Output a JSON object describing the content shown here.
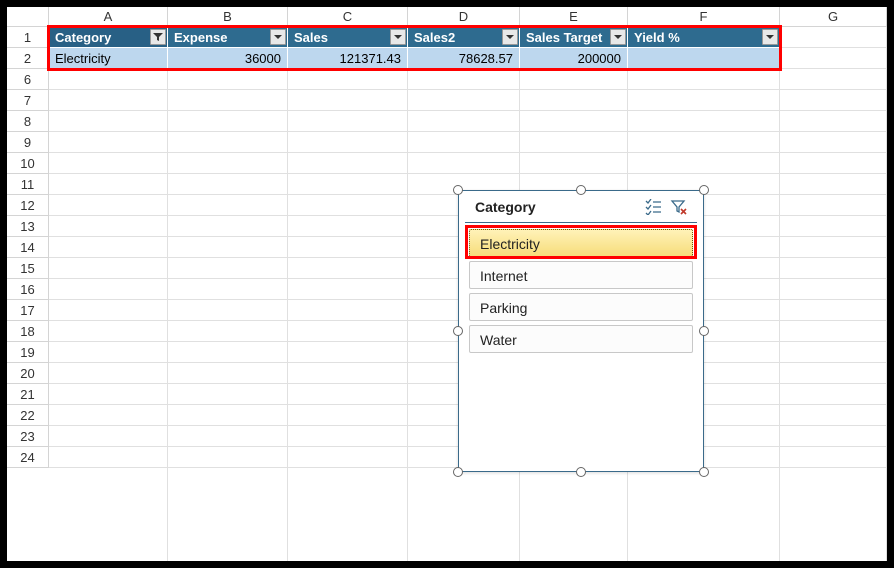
{
  "columns": [
    "A",
    "B",
    "C",
    "D",
    "E",
    "F",
    "G"
  ],
  "rows": [
    "1",
    "2",
    "6",
    "7",
    "8",
    "9",
    "10",
    "11",
    "12",
    "13",
    "14",
    "15",
    "16",
    "17",
    "18",
    "19",
    "20",
    "21",
    "22",
    "23",
    "24"
  ],
  "table": {
    "headers": [
      "Category",
      "Expense",
      "Sales",
      "Sales2",
      "Sales Target",
      "Yield %"
    ],
    "data_row": {
      "category": "Electricity",
      "expense": "36000",
      "sales": "121371.43",
      "sales2": "78628.57",
      "sales_target": "200000",
      "yield": ""
    }
  },
  "slicer": {
    "title": "Category",
    "items": [
      {
        "label": "Electricity",
        "selected": true
      },
      {
        "label": "Internet",
        "selected": false
      },
      {
        "label": "Parking",
        "selected": false
      },
      {
        "label": "Water",
        "selected": false
      }
    ]
  }
}
